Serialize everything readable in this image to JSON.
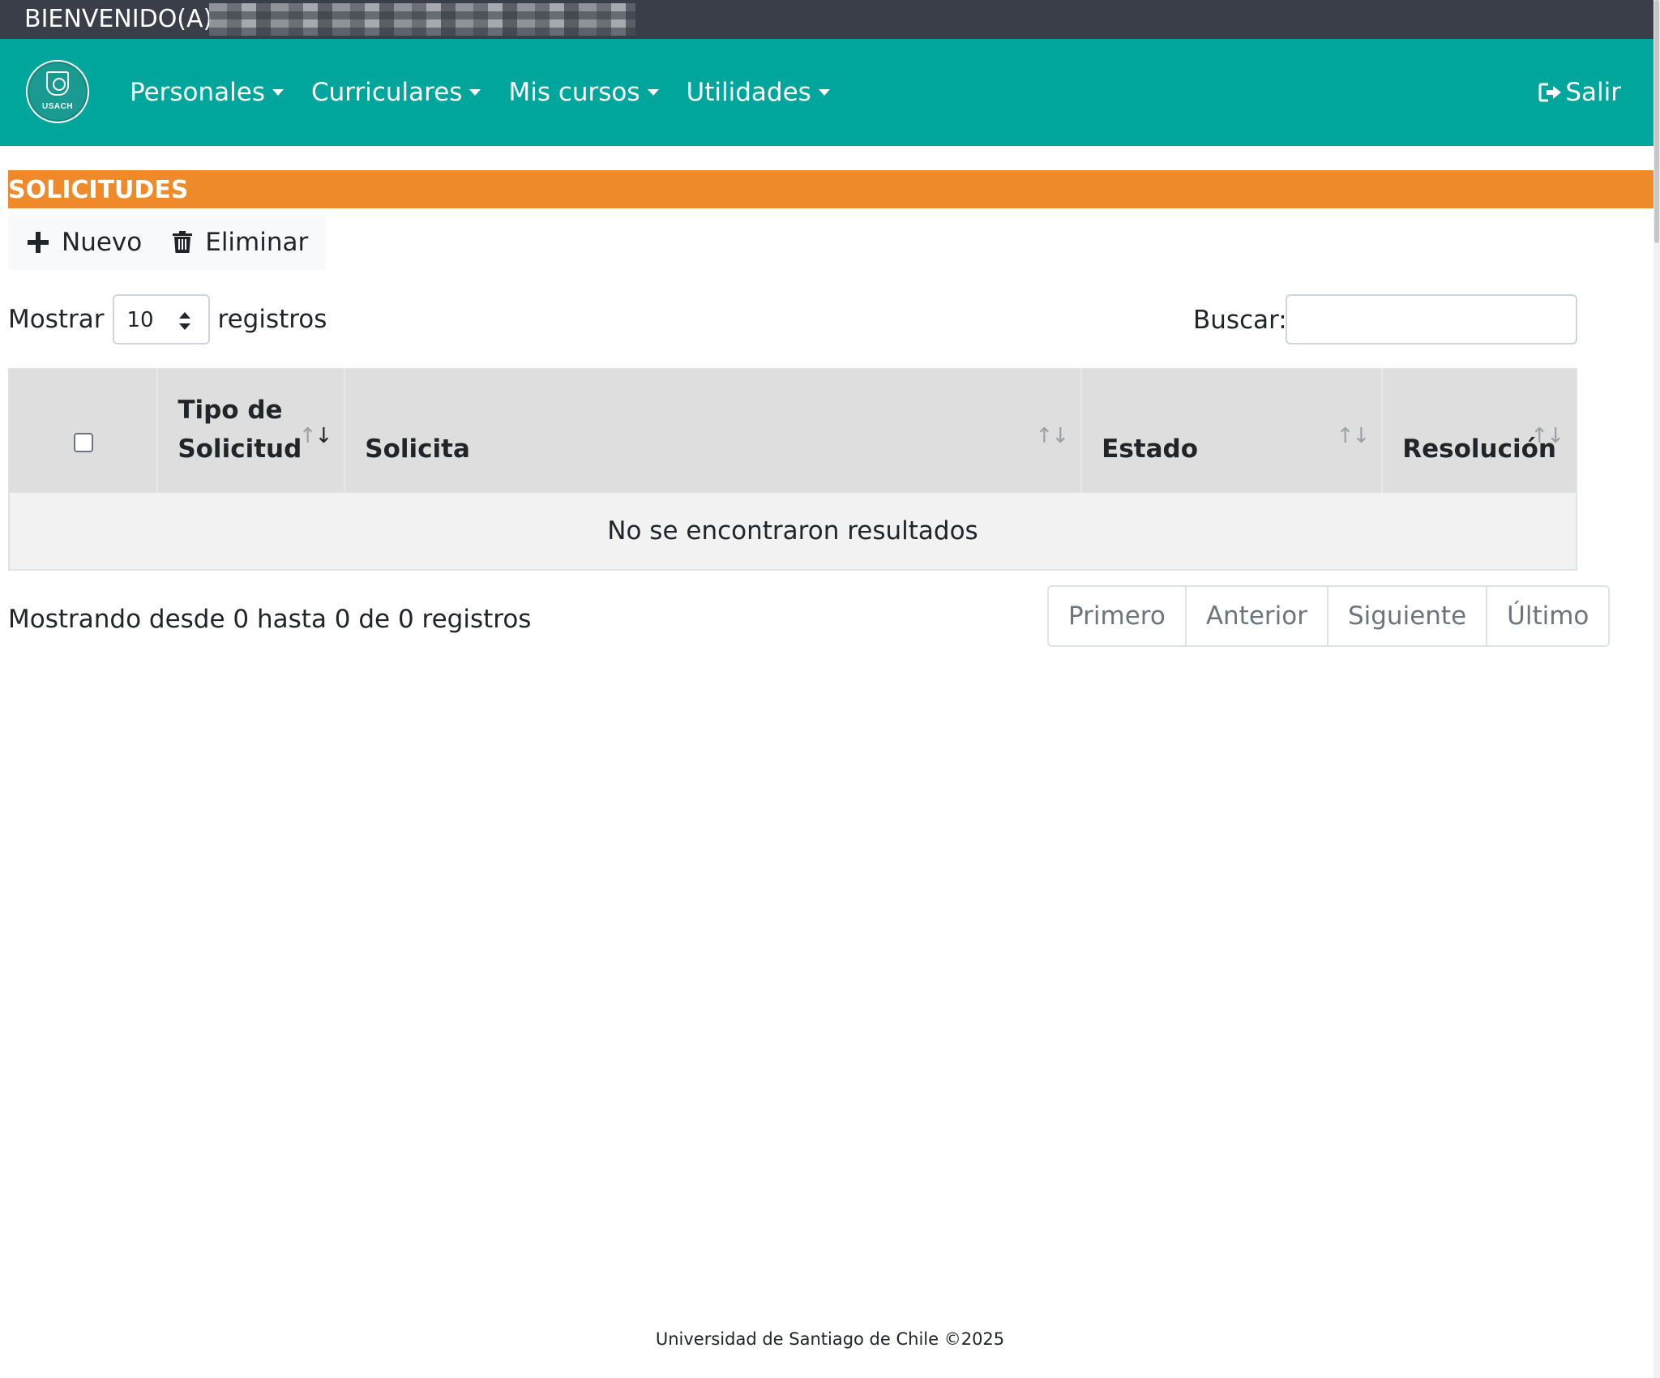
{
  "welcome": {
    "text": "BIENVENIDO(A)"
  },
  "logo": {
    "text": "USACH"
  },
  "nav": {
    "items": [
      {
        "label": "Personales"
      },
      {
        "label": "Curriculares"
      },
      {
        "label": "Mis cursos"
      },
      {
        "label": "Utilidades"
      }
    ],
    "logout_label": "Salir"
  },
  "section": {
    "title": "SOLICITUDES"
  },
  "toolbar": {
    "new_label": "Nuevo",
    "delete_label": "Eliminar"
  },
  "table_controls": {
    "show_label": "Mostrar",
    "page_size": "10",
    "records_label": "registros",
    "search_label": "Buscar:",
    "search_value": ""
  },
  "table": {
    "columns": [
      {
        "label": "Tipo de Solicitud"
      },
      {
        "label": "Solicita"
      },
      {
        "label": "Estado"
      },
      {
        "label": "Resolución"
      }
    ],
    "empty_message": "No se encontraron resultados"
  },
  "info": {
    "text": "Mostrando desde 0 hasta 0 de 0 registros"
  },
  "pagination": {
    "first": "Primero",
    "previous": "Anterior",
    "next": "Siguiente",
    "last": "Último"
  },
  "footer": {
    "text": "Universidad de Santiago de Chile ©2025"
  },
  "colors": {
    "top_bar": "#393e48",
    "navbar": "#00a69c",
    "section_header": "#ef8a2a",
    "table_header": "#dedede"
  },
  "icons": {
    "new": "plus-icon",
    "delete": "trash-icon",
    "logout": "sign-out-icon"
  }
}
